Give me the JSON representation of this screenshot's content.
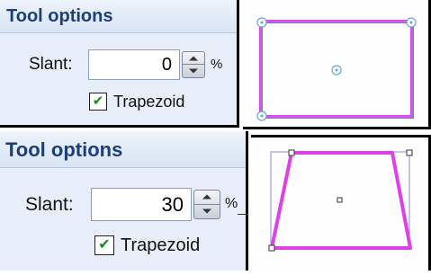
{
  "top_panel": {
    "title": "Tool options",
    "slant_label": "Slant:",
    "slant_value": "0",
    "unit": "%",
    "checkbox_label": "Trapezoid",
    "checked": true
  },
  "bottom_panel": {
    "title": "Tool options",
    "slant_label": "Slant:",
    "slant_value": "30",
    "unit": "%",
    "checkbox_label": "Trapezoid",
    "checked": true
  },
  "colors": {
    "shape_stroke": "#e040e6",
    "handle": "#6aa3e0",
    "panel_title": "#1b3f78"
  },
  "icons": {
    "check": "✔",
    "spin_up": "up-arrow-icon",
    "spin_down": "down-arrow-icon"
  }
}
